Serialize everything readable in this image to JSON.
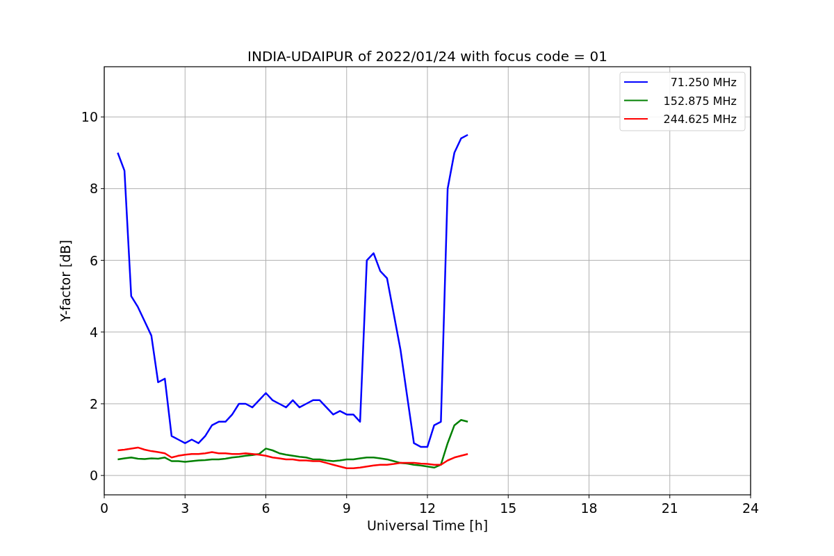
{
  "figure": {
    "chart_data": {
      "type": "line",
      "title": "INDIA-UDAIPUR of 2022/01/24 with focus code = 01",
      "xlabel": "Universal Time [h]",
      "ylabel": "Y-factor [dB]",
      "x": [
        0.5,
        0.75,
        1.0,
        1.25,
        1.5,
        1.75,
        2.0,
        2.25,
        2.5,
        2.75,
        3.0,
        3.25,
        3.5,
        3.75,
        4.0,
        4.25,
        4.5,
        4.75,
        5.0,
        5.25,
        5.5,
        5.75,
        6.0,
        6.25,
        6.5,
        6.75,
        7.0,
        7.25,
        7.5,
        7.75,
        8.0,
        8.25,
        8.5,
        8.75,
        9.0,
        9.25,
        9.5,
        9.75,
        10.0,
        10.25,
        10.5,
        10.75,
        11.0,
        11.25,
        11.5,
        11.75,
        12.0,
        12.25,
        12.5,
        12.75,
        13.0,
        13.25,
        13.5
      ],
      "series": [
        {
          "name": "71.250 MHz",
          "color": "#0000ff",
          "values": [
            9.0,
            8.5,
            5.0,
            4.7,
            4.3,
            3.9,
            2.6,
            2.7,
            1.1,
            1.0,
            0.9,
            1.0,
            0.9,
            1.1,
            1.4,
            1.5,
            1.5,
            1.7,
            2.0,
            2.0,
            1.9,
            2.1,
            2.3,
            2.1,
            2.0,
            1.9,
            2.1,
            1.9,
            2.0,
            2.1,
            2.1,
            1.9,
            1.7,
            1.8,
            1.7,
            1.7,
            1.5,
            6.0,
            6.2,
            5.7,
            5.5,
            4.5,
            3.5,
            2.2,
            0.9,
            0.8,
            0.8,
            1.4,
            1.5,
            8.0,
            9.0,
            9.4,
            9.5
          ]
        },
        {
          "name": "152.875 MHz",
          "color": "#008000",
          "values": [
            0.45,
            0.48,
            0.5,
            0.47,
            0.46,
            0.48,
            0.47,
            0.5,
            0.4,
            0.4,
            0.38,
            0.4,
            0.42,
            0.43,
            0.45,
            0.45,
            0.47,
            0.5,
            0.52,
            0.55,
            0.57,
            0.6,
            0.75,
            0.7,
            0.62,
            0.58,
            0.55,
            0.52,
            0.5,
            0.45,
            0.45,
            0.42,
            0.4,
            0.42,
            0.45,
            0.45,
            0.48,
            0.5,
            0.5,
            0.48,
            0.45,
            0.4,
            0.35,
            0.33,
            0.3,
            0.28,
            0.25,
            0.22,
            0.3,
            0.9,
            1.4,
            1.55,
            1.5
          ]
        },
        {
          "name": "244.625 MHz",
          "color": "#ff0000",
          "values": [
            0.7,
            0.72,
            0.75,
            0.78,
            0.72,
            0.68,
            0.65,
            0.62,
            0.5,
            0.55,
            0.58,
            0.6,
            0.6,
            0.62,
            0.65,
            0.62,
            0.62,
            0.6,
            0.6,
            0.62,
            0.6,
            0.58,
            0.55,
            0.5,
            0.48,
            0.45,
            0.45,
            0.42,
            0.42,
            0.4,
            0.4,
            0.35,
            0.3,
            0.25,
            0.2,
            0.2,
            0.22,
            0.25,
            0.28,
            0.3,
            0.3,
            0.32,
            0.35,
            0.35,
            0.35,
            0.33,
            0.32,
            0.3,
            0.3,
            0.42,
            0.5,
            0.55,
            0.6
          ]
        }
      ],
      "xlim": [
        0,
        24
      ],
      "ylim": [
        -0.54,
        11.4
      ],
      "xticks": [
        0,
        3,
        6,
        9,
        12,
        15,
        18,
        21,
        24
      ],
      "yticks": [
        0,
        2,
        4,
        6,
        8,
        10
      ],
      "grid": true,
      "legend": true
    }
  }
}
